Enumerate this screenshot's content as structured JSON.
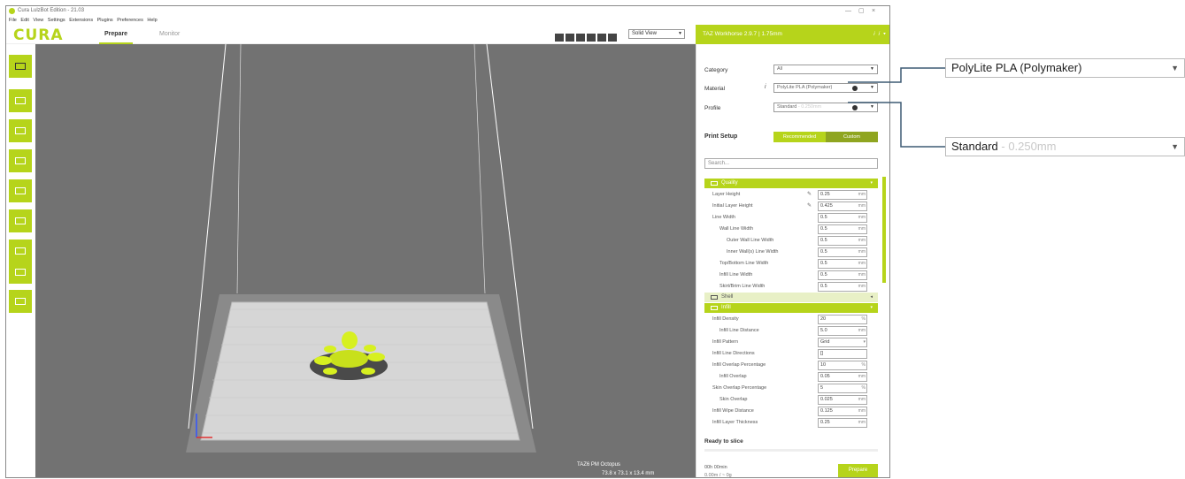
{
  "window": {
    "title": "Cura LulzBot Edition - 21.03",
    "controls": [
      "—",
      "▢",
      "×"
    ]
  },
  "menu": [
    "File",
    "Edit",
    "View",
    "Settings",
    "Extensions",
    "Plugins",
    "Preferences",
    "Help"
  ],
  "header": {
    "logo": "CURA",
    "tabs": [
      {
        "label": "Prepare",
        "active": true
      },
      {
        "label": "Monitor",
        "active": false
      }
    ],
    "view_mode": "Solid View"
  },
  "printer": {
    "name": "TAZ Workhorse 2.9.7 | 1.75mm",
    "icons": [
      "info-icon",
      "info-icon",
      "menu-icon"
    ]
  },
  "panel": {
    "category_label": "Category",
    "category_value": "All",
    "material_label": "Material",
    "material_value": "PolyLite PLA (Polymaker)",
    "profile_label": "Profile",
    "profile_value": "Standard",
    "profile_value_suffix": " - 0.250mm",
    "print_setup_label": "Print Setup",
    "mode_recommended": "Recommended",
    "mode_custom": "Custom",
    "search_placeholder": "Search...",
    "sections": [
      {
        "name": "Quality",
        "style": "open",
        "rows": [
          {
            "label": "Layer Height",
            "value": "0.25",
            "unit": "mm",
            "indent": 0,
            "pen": true
          },
          {
            "label": "Initial Layer Height",
            "value": "0.425",
            "unit": "mm",
            "indent": 0,
            "pen": true
          },
          {
            "label": "Line Width",
            "value": "0.5",
            "unit": "mm",
            "indent": 0,
            "pen": false
          },
          {
            "label": "Wall Line Width",
            "value": "0.5",
            "unit": "mm",
            "indent": 1,
            "pen": false
          },
          {
            "label": "Outer Wall Line Width",
            "value": "0.5",
            "unit": "mm",
            "indent": 2,
            "pen": false
          },
          {
            "label": "Inner Wall(s) Line Width",
            "value": "0.5",
            "unit": "mm",
            "indent": 2,
            "pen": false
          },
          {
            "label": "Top/Bottom Line Width",
            "value": "0.5",
            "unit": "mm",
            "indent": 1,
            "pen": false
          },
          {
            "label": "Infill Line Width",
            "value": "0.5",
            "unit": "mm",
            "indent": 1,
            "pen": false
          },
          {
            "label": "Skirt/Brim Line Width",
            "value": "0.5",
            "unit": "mm",
            "indent": 1,
            "pen": false
          }
        ]
      },
      {
        "name": "Shell",
        "style": "shell",
        "rows": []
      },
      {
        "name": "Infill",
        "style": "open",
        "rows": [
          {
            "label": "Infill Density",
            "value": "20",
            "unit": "%",
            "indent": 0,
            "pen": false
          },
          {
            "label": "Infill Line Distance",
            "value": "5.0",
            "unit": "mm",
            "indent": 1,
            "pen": false
          },
          {
            "label": "Infill Pattern",
            "value": "Grid",
            "unit": "▾",
            "indent": 0,
            "pen": false
          },
          {
            "label": "Infill Line Directions",
            "value": "[]",
            "unit": "",
            "indent": 0,
            "pen": false
          },
          {
            "label": "Infill Overlap Percentage",
            "value": "10",
            "unit": "%",
            "indent": 0,
            "pen": false
          },
          {
            "label": "Infill Overlap",
            "value": "0.05",
            "unit": "mm",
            "indent": 1,
            "pen": false
          },
          {
            "label": "Skin Overlap Percentage",
            "value": "5",
            "unit": "%",
            "indent": 0,
            "pen": false
          },
          {
            "label": "Skin Overlap",
            "value": "0.025",
            "unit": "mm",
            "indent": 1,
            "pen": false
          },
          {
            "label": "Infill Wipe Distance",
            "value": "0.125",
            "unit": "mm",
            "indent": 0,
            "pen": false
          },
          {
            "label": "Infill Layer Thickness",
            "value": "0.25",
            "unit": "mm",
            "indent": 0,
            "pen": false
          }
        ]
      }
    ],
    "ready_label": "Ready to slice",
    "print_time": "00h 00min",
    "material_usage": "0.00m / ~ 0g",
    "prepare_button": "Prepare"
  },
  "viewport": {
    "filename": "TAZ6 PM Octopus",
    "dims": "73.8 x 73.1 x 13.4 mm"
  },
  "callouts": {
    "material": "PolyLite PLA (Polymaker)",
    "profile": "Standard",
    "profile_suffix": " - 0.250mm"
  },
  "colors": {
    "accent": "#b6d41b",
    "viewport": "#727272",
    "model": "#d7f020"
  }
}
